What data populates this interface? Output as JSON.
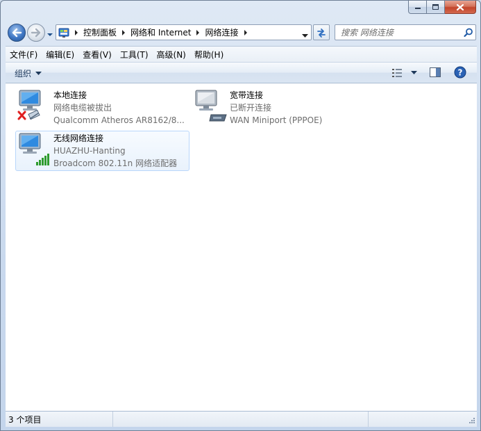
{
  "address": {
    "crumbs": [
      "控制面板",
      "网络和 Internet",
      "网络连接"
    ]
  },
  "search": {
    "placeholder": "搜索 网络连接"
  },
  "menu": [
    "文件(F)",
    "编辑(E)",
    "查看(V)",
    "工具(T)",
    "高级(N)",
    "帮助(H)"
  ],
  "toolbar": {
    "organize_label": "组织"
  },
  "connections": [
    {
      "name": "本地连接",
      "status": "网络电缆被拔出",
      "device": "Qualcomm Atheros AR8162/8...",
      "icon": "ethernet-disconnected-icon"
    },
    {
      "name": "宽带连接",
      "status": "已断开连接",
      "device": "WAN Miniport (PPPOE)",
      "icon": "broadband-modem-icon"
    },
    {
      "name": "无线网络连接",
      "status": "HUAZHU-Hanting",
      "device": "Broadcom 802.11n 网络适配器",
      "icon": "wireless-signal-icon"
    }
  ],
  "statusbar": {
    "count": "3 个项目"
  },
  "colors": {
    "link_blue": "#1e395b",
    "secondary_text": "#6d6d6d",
    "selection_border": "#b8d6fb"
  }
}
